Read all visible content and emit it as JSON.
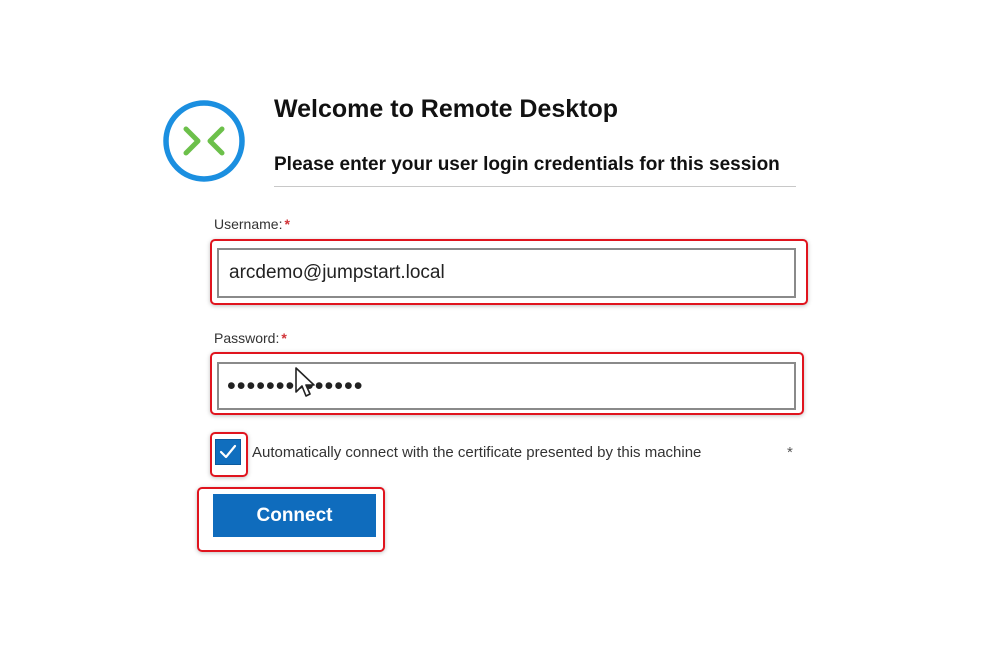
{
  "header": {
    "title": "Welcome to Remote Desktop",
    "subtitle": "Please enter your user login credentials for this session",
    "logo_icon": "remote-desktop-logo"
  },
  "form": {
    "username_label": "Username:",
    "username_value": "arcdemo@jumpstart.local",
    "password_label": "Password:",
    "password_value": "••••••••••••••",
    "required_mark": "*",
    "auto_connect_checked": true,
    "auto_connect_label": "Automatically connect with the certificate presented by this machine",
    "auto_connect_asterisk": "*",
    "connect_label": "Connect"
  },
  "colors": {
    "accent": "#0f6cbd",
    "logo_ring": "#1b8fe0",
    "logo_chevron": "#6cc04a",
    "highlight": "#e0141e",
    "required": "#d13438"
  }
}
